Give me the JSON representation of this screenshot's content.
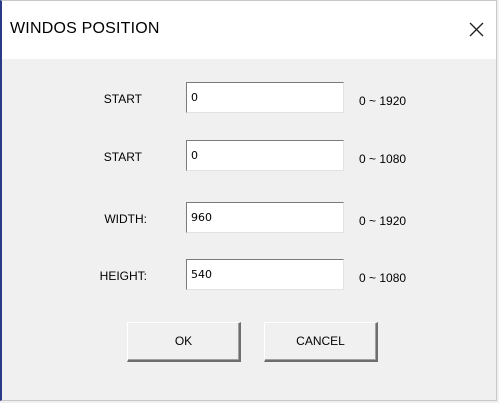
{
  "window": {
    "title": "WINDOS POSITION"
  },
  "fields": [
    {
      "label": "START",
      "value": "0",
      "range": "0 ~ 1920"
    },
    {
      "label": "START",
      "value": "0",
      "range": "0 ~ 1080"
    },
    {
      "label": "WIDTH:",
      "value": "960",
      "range": "0 ~ 1920"
    },
    {
      "label": "HEIGHT:",
      "value": "540",
      "range": "0 ~ 1080"
    }
  ],
  "buttons": {
    "ok": "OK",
    "cancel": "CANCEL"
  },
  "icons": {
    "close": "close-icon"
  }
}
